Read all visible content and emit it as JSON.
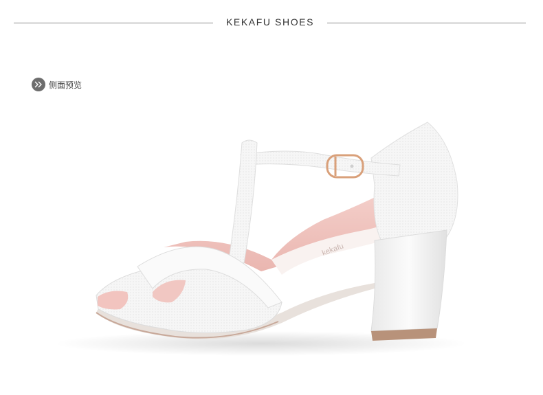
{
  "header": {
    "brand": "KEKAFU SHOES"
  },
  "view_label": {
    "text": "侧面预览",
    "icon": "double-chevron-right-icon"
  },
  "product": {
    "insole_print": "kekafu"
  },
  "colors": {
    "shoe": "#f7f7f7",
    "lining": "#f0c6c2",
    "heel_tip": "#b8927a",
    "buckle": "#d9a07a"
  }
}
